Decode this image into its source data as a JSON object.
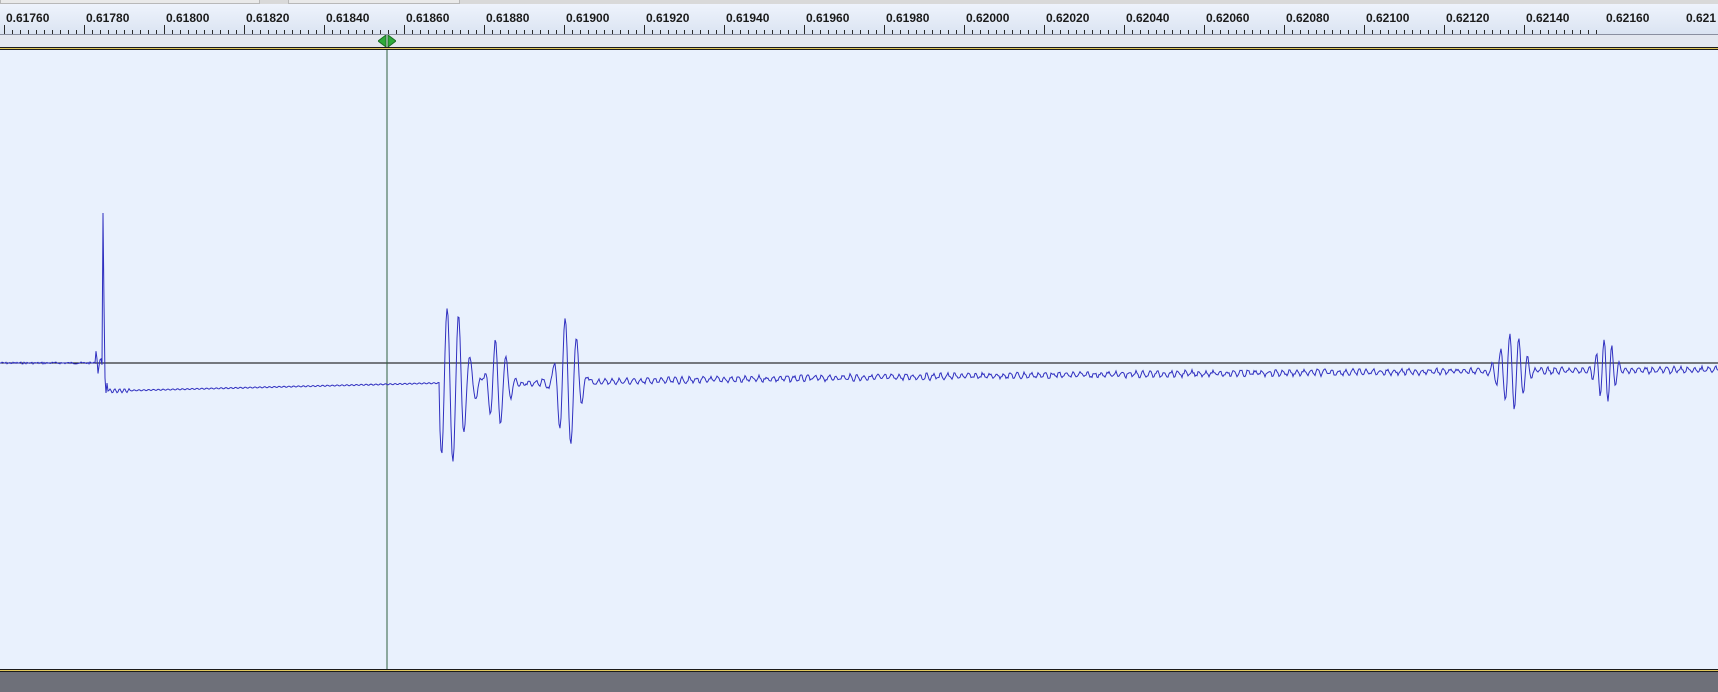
{
  "ruler": {
    "tick_labels": [
      "0.61760",
      "0.61780",
      "0.61800",
      "0.61820",
      "0.61840",
      "0.61860",
      "0.61880",
      "0.61900",
      "0.61920",
      "0.61940",
      "0.61960",
      "0.61980",
      "0.62000",
      "0.62020",
      "0.62040",
      "0.62060",
      "0.62080",
      "0.62100",
      "0.62120",
      "0.62140",
      "0.62160",
      "0.621"
    ]
  },
  "colors": {
    "waveform": "#3030c0",
    "background": "#e9f1fd",
    "cursor": "#2f5f3f",
    "marker": "#2eaa3a"
  },
  "icons": {
    "cursor_marker": "play-position-icon"
  }
}
